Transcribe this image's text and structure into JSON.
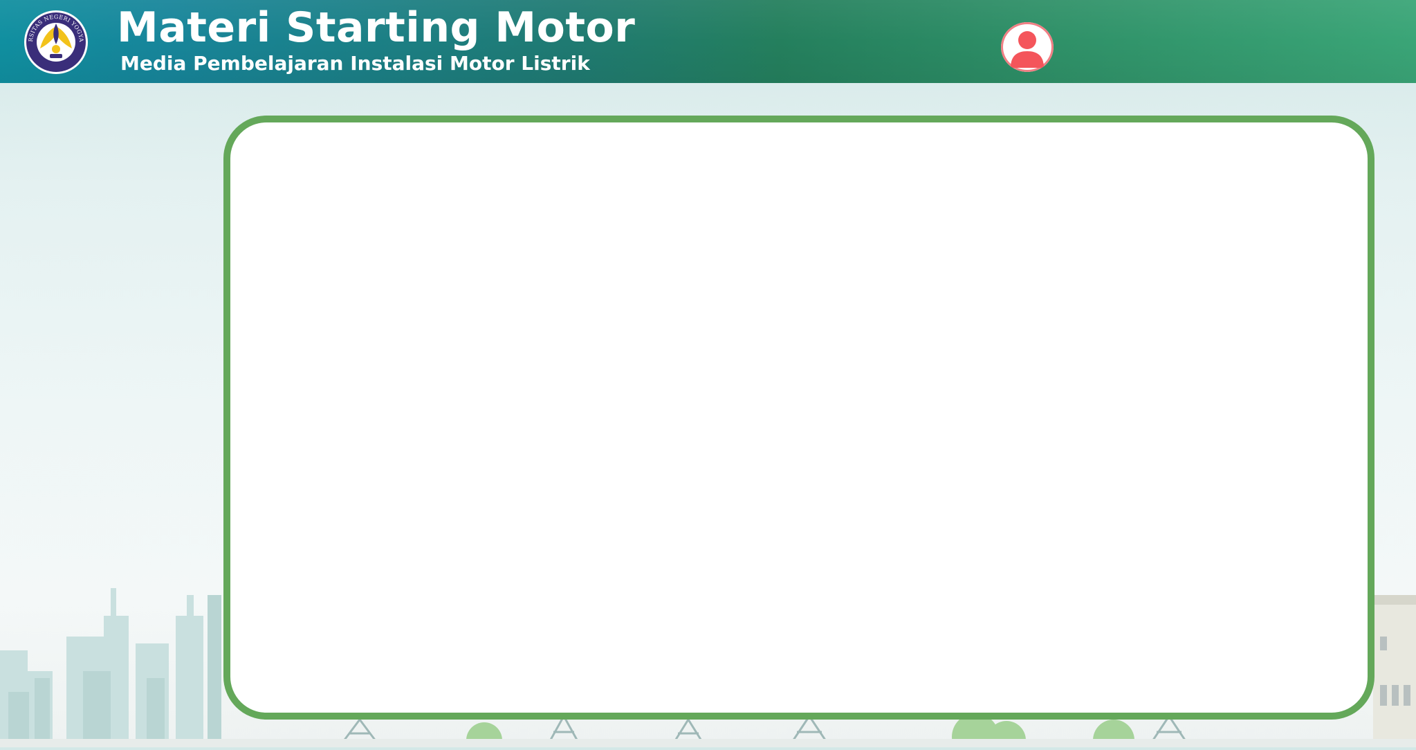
{
  "header": {
    "title": "Materi Starting Motor",
    "subtitle": "Media Pembelajaran Instalasi Motor Listrik",
    "logo": {
      "icon": "university-seal-icon",
      "text": "UNIVERSITAS NEGERI YOGYAKARTA"
    },
    "profile_button": {
      "icon": "user-profile-icon"
    }
  },
  "content": {
    "items": []
  },
  "colors": {
    "header_start": "#108fa0",
    "header_mid": "#247f5d",
    "header_end": "#3aa577",
    "card_border": "#64a85a",
    "profile_accent": "#f4555b",
    "page_background": "#e4f1f1"
  }
}
